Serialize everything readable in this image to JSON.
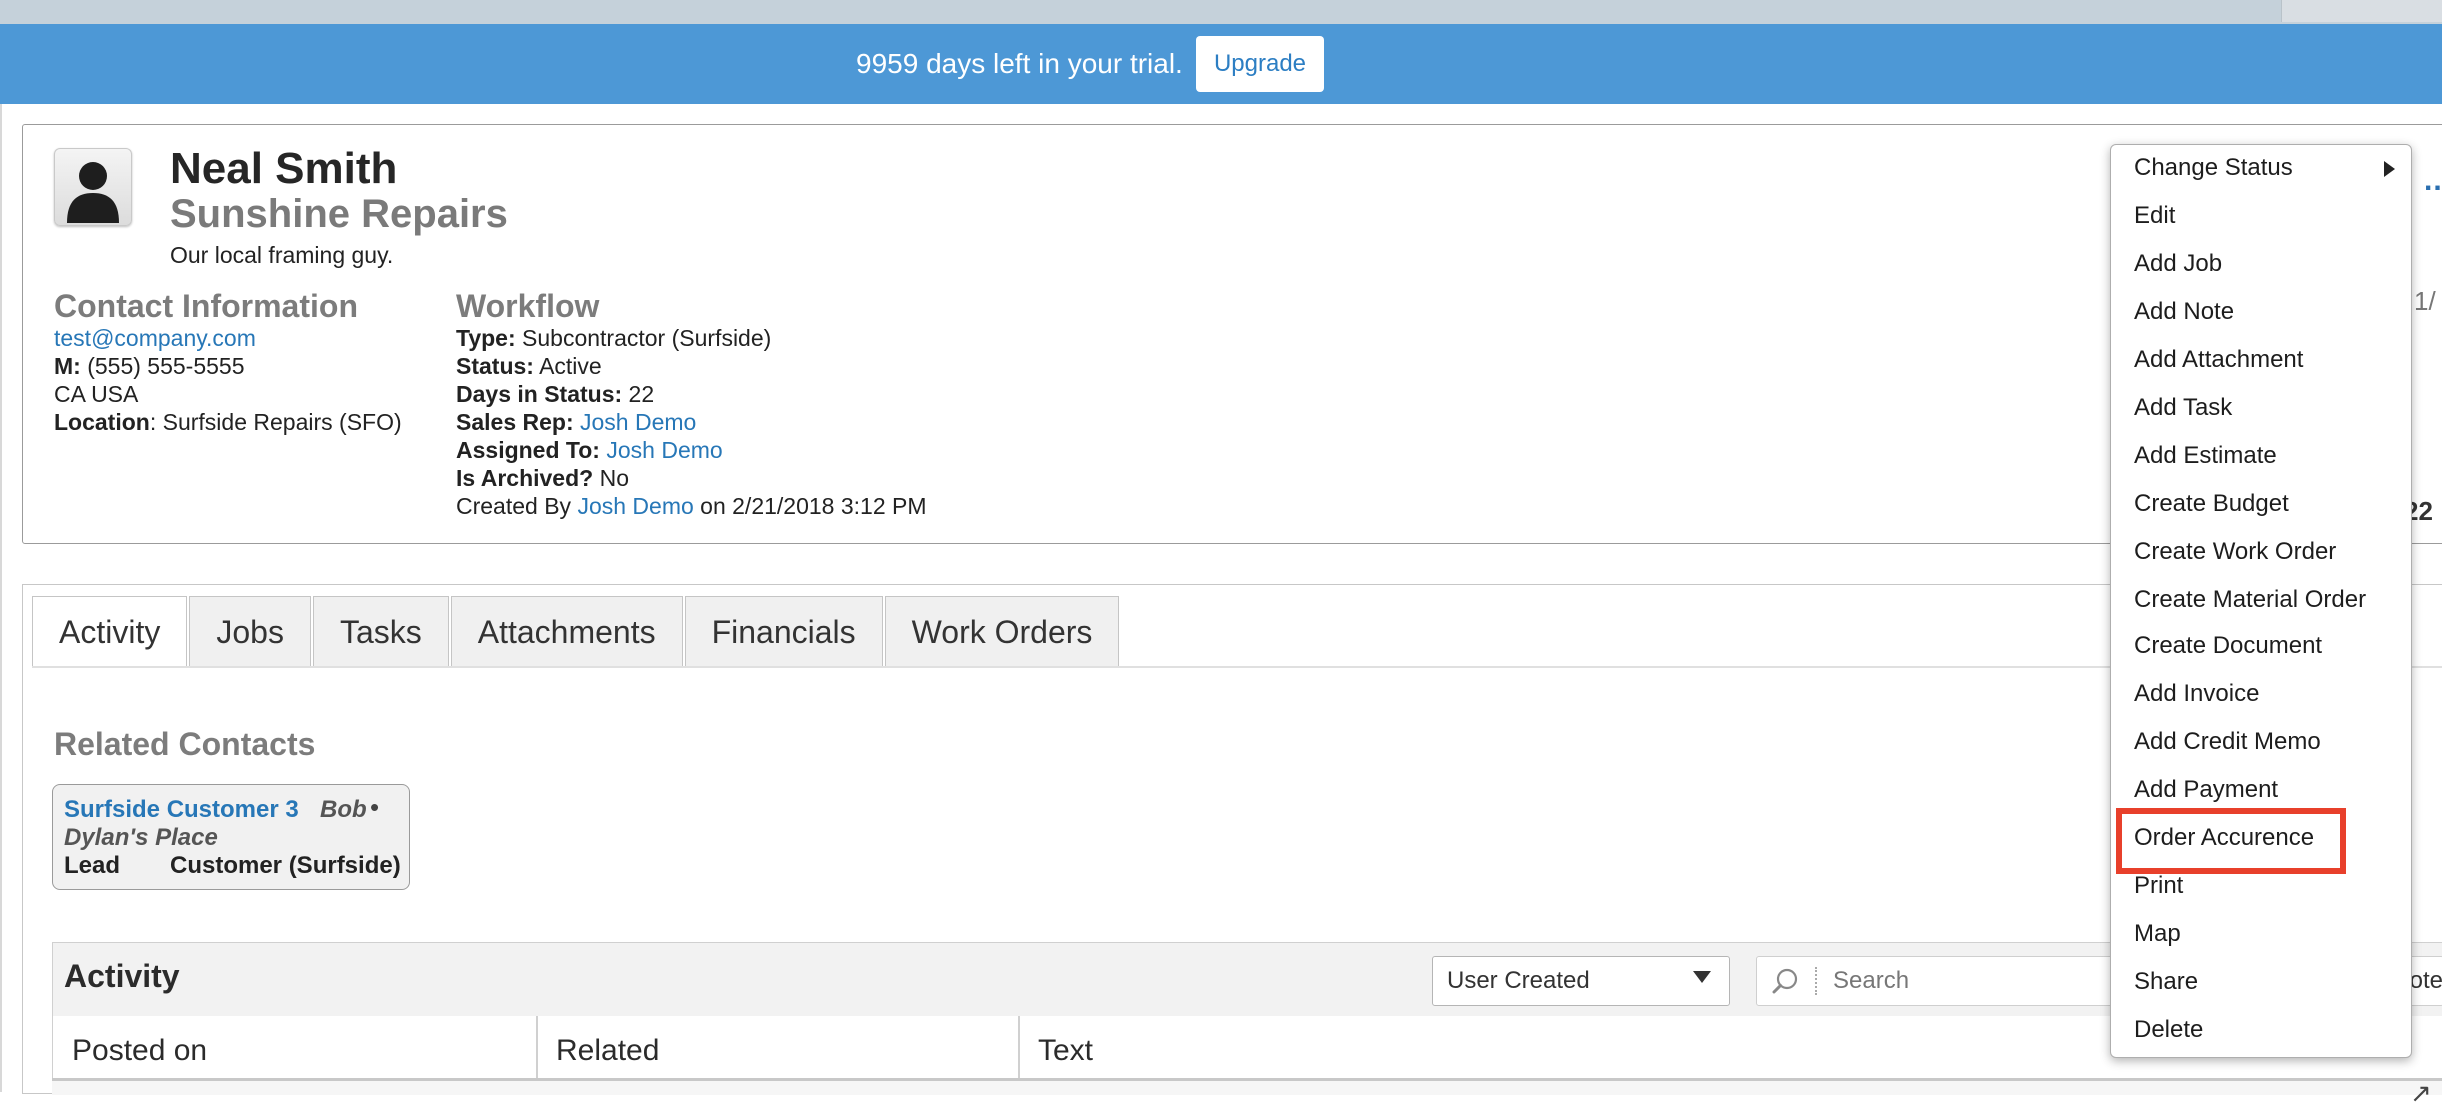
{
  "banner": {
    "days_left": "9959",
    "message": "9959 days left in your trial.",
    "upgrade_label": "Upgrade"
  },
  "contact": {
    "name": "Neal Smith",
    "company": "Sunshine Repairs",
    "tagline": "Our local framing guy."
  },
  "contact_info": {
    "title": "Contact Information",
    "email": "test@company.com",
    "mobile_label": "M:",
    "mobile": " (555) 555-5555",
    "region": "CA USA",
    "location_label": "Location",
    "location": ": Surfside Repairs (SFO)"
  },
  "workflow": {
    "title": "Workflow",
    "type_label": "Type:",
    "type": " Subcontractor (Surfside)",
    "status_label": "Status:",
    "status": " Active",
    "days_label": "Days in Status:",
    "days": " 22",
    "sales_rep_label": "Sales Rep:",
    "sales_rep": "Josh Demo",
    "assigned_label": "Assigned To:",
    "assigned": "Josh Demo",
    "archived_label": "Is Archived?",
    "archived": " No",
    "created_prefix": "Created By ",
    "created_by": "Josh Demo",
    "created_suffix": " on 2/21/2018 3:12 PM"
  },
  "tabs": [
    {
      "label": "Activity",
      "active": true
    },
    {
      "label": "Jobs"
    },
    {
      "label": "Tasks"
    },
    {
      "label": "Attachments"
    },
    {
      "label": "Financials"
    },
    {
      "label": "Work Orders"
    }
  ],
  "related": {
    "title": "Related Contacts",
    "card": {
      "name": "Surfside Customer 3",
      "assignee": "Bob",
      "place": "Dylan's Place",
      "status": "Lead",
      "type": "Customer (Surfside)"
    }
  },
  "activity": {
    "title": "Activity",
    "filter_value": "User Created",
    "search_placeholder": "Search",
    "trailing_text": "ote",
    "columns": [
      "Posted on",
      "Related",
      "Text"
    ]
  },
  "peek": {
    "dots": "..",
    "date": "1/",
    "number": "22"
  },
  "menu": {
    "items": [
      "Change Status",
      "Edit",
      "Add Job",
      "Add Note",
      "Add Attachment",
      "Add Task",
      "Add Estimate",
      "Create Budget",
      "Create Work Order",
      "Create Material Order",
      "Create Document",
      "Add Invoice",
      "Add Credit Memo",
      "Add Payment",
      "Order Accurence",
      "Print",
      "Map",
      "Share",
      "Delete"
    ],
    "highlighted": "Order Accurence"
  },
  "colors": {
    "banner": "#4d98d6",
    "link": "#2777b7",
    "highlight": "#e8402b"
  }
}
